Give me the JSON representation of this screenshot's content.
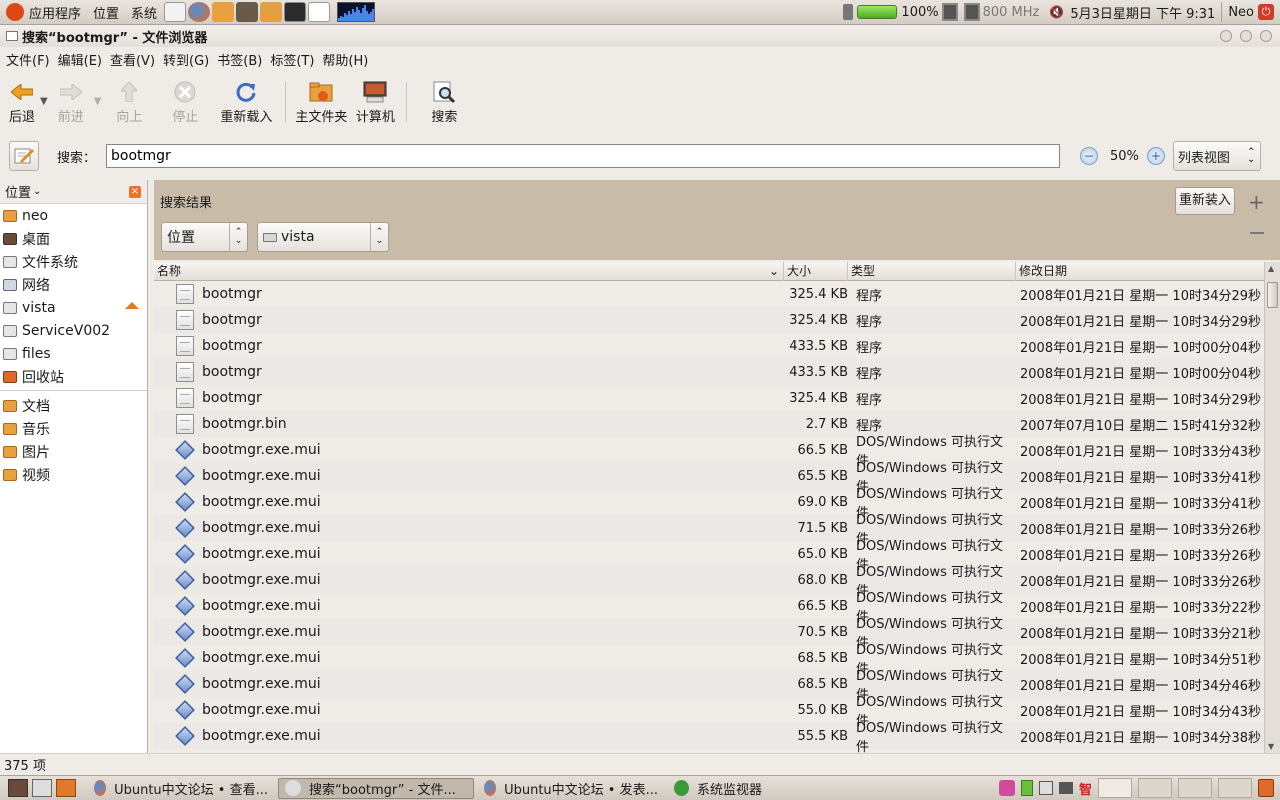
{
  "top_panel": {
    "menus": [
      "应用程序",
      "位置",
      "系统"
    ],
    "battery": "100%",
    "cpu_freq": "800 MHz",
    "datetime": "5月3日星期日 下午 9:31",
    "user": "Neo"
  },
  "window": {
    "title": "搜索“bootmgr” - 文件浏览器"
  },
  "menubar": [
    "文件(F)",
    "编辑(E)",
    "查看(V)",
    "转到(G)",
    "书签(B)",
    "标签(T)",
    "帮助(H)"
  ],
  "toolbar": {
    "back": "后退",
    "forward": "前进",
    "up": "向上",
    "stop": "停止",
    "reload": "重新载入",
    "home": "主文件夹",
    "computer": "计算机",
    "search": "搜索"
  },
  "search": {
    "label": "搜索：",
    "value": "bootmgr",
    "zoom": "50%",
    "view_mode": "列表视图"
  },
  "sidebar": {
    "title": "位置",
    "places": [
      {
        "label": "neo",
        "icon": "home-folder-icon"
      },
      {
        "label": "桌面",
        "icon": "desktop-icon"
      },
      {
        "label": "文件系统",
        "icon": "drive-icon"
      },
      {
        "label": "网络",
        "icon": "network-icon"
      },
      {
        "label": "vista",
        "icon": "drive-icon",
        "eject": true
      },
      {
        "label": "ServiceV002",
        "icon": "drive-icon"
      },
      {
        "label": "files",
        "icon": "drive-icon"
      },
      {
        "label": "回收站",
        "icon": "trash-icon"
      }
    ],
    "bookmarks": [
      {
        "label": "文档",
        "icon": "folder-icon"
      },
      {
        "label": "音乐",
        "icon": "folder-icon"
      },
      {
        "label": "图片",
        "icon": "folder-icon"
      },
      {
        "label": "视频",
        "icon": "folder-icon"
      }
    ]
  },
  "results": {
    "title": "搜索结果",
    "reload": "重新装入",
    "criteria_type": "位置",
    "criteria_value": "vista"
  },
  "columns": {
    "name": "名称",
    "size": "大小",
    "type": "类型",
    "date": "修改日期"
  },
  "files": [
    {
      "name": "bootmgr",
      "size": "325.4 KB",
      "type": "程序",
      "date": "2008年01月21日 星期一 10时34分29秒",
      "icon": "program"
    },
    {
      "name": "bootmgr",
      "size": "325.4 KB",
      "type": "程序",
      "date": "2008年01月21日 星期一 10时34分29秒",
      "icon": "program"
    },
    {
      "name": "bootmgr",
      "size": "433.5 KB",
      "type": "程序",
      "date": "2008年01月21日 星期一 10时00分04秒",
      "icon": "program"
    },
    {
      "name": "bootmgr",
      "size": "433.5 KB",
      "type": "程序",
      "date": "2008年01月21日 星期一 10时00分04秒",
      "icon": "program"
    },
    {
      "name": "bootmgr",
      "size": "325.4 KB",
      "type": "程序",
      "date": "2008年01月21日 星期一 10时34分29秒",
      "icon": "program"
    },
    {
      "name": "bootmgr.bin",
      "size": "2.7 KB",
      "type": "程序",
      "date": "2007年07月10日 星期二 15时41分32秒",
      "icon": "program"
    },
    {
      "name": "bootmgr.exe.mui",
      "size": "66.5 KB",
      "type": "DOS/Windows 可执行文件",
      "date": "2008年01月21日 星期一 10时33分43秒",
      "icon": "exe"
    },
    {
      "name": "bootmgr.exe.mui",
      "size": "65.5 KB",
      "type": "DOS/Windows 可执行文件",
      "date": "2008年01月21日 星期一 10时33分41秒",
      "icon": "exe"
    },
    {
      "name": "bootmgr.exe.mui",
      "size": "69.0 KB",
      "type": "DOS/Windows 可执行文件",
      "date": "2008年01月21日 星期一 10时33分41秒",
      "icon": "exe"
    },
    {
      "name": "bootmgr.exe.mui",
      "size": "71.5 KB",
      "type": "DOS/Windows 可执行文件",
      "date": "2008年01月21日 星期一 10时33分26秒",
      "icon": "exe"
    },
    {
      "name": "bootmgr.exe.mui",
      "size": "65.0 KB",
      "type": "DOS/Windows 可执行文件",
      "date": "2008年01月21日 星期一 10时33分26秒",
      "icon": "exe"
    },
    {
      "name": "bootmgr.exe.mui",
      "size": "68.0 KB",
      "type": "DOS/Windows 可执行文件",
      "date": "2008年01月21日 星期一 10时33分26秒",
      "icon": "exe"
    },
    {
      "name": "bootmgr.exe.mui",
      "size": "66.5 KB",
      "type": "DOS/Windows 可执行文件",
      "date": "2008年01月21日 星期一 10时33分22秒",
      "icon": "exe"
    },
    {
      "name": "bootmgr.exe.mui",
      "size": "70.5 KB",
      "type": "DOS/Windows 可执行文件",
      "date": "2008年01月21日 星期一 10时33分21秒",
      "icon": "exe"
    },
    {
      "name": "bootmgr.exe.mui",
      "size": "68.5 KB",
      "type": "DOS/Windows 可执行文件",
      "date": "2008年01月21日 星期一 10时34分51秒",
      "icon": "exe"
    },
    {
      "name": "bootmgr.exe.mui",
      "size": "68.5 KB",
      "type": "DOS/Windows 可执行文件",
      "date": "2008年01月21日 星期一 10时34分46秒",
      "icon": "exe"
    },
    {
      "name": "bootmgr.exe.mui",
      "size": "55.0 KB",
      "type": "DOS/Windows 可执行文件",
      "date": "2008年01月21日 星期一 10时34分43秒",
      "icon": "exe"
    },
    {
      "name": "bootmgr.exe.mui",
      "size": "55.5 KB",
      "type": "DOS/Windows 可执行文件",
      "date": "2008年01月21日 星期一 10时34分38秒",
      "icon": "exe"
    }
  ],
  "status": "375 项",
  "taskbar": [
    {
      "label": "Ubuntu中文论坛 • 查看...",
      "icon": "firefox-icon",
      "active": false
    },
    {
      "label": "搜索“bootmgr” - 文件...",
      "icon": "file-browser-icon",
      "active": true
    },
    {
      "label": "Ubuntu中文论坛 • 发表...",
      "icon": "firefox-icon",
      "active": false
    },
    {
      "label": "系统监视器",
      "icon": "system-monitor-icon",
      "active": false
    }
  ],
  "tray_ime": "智"
}
